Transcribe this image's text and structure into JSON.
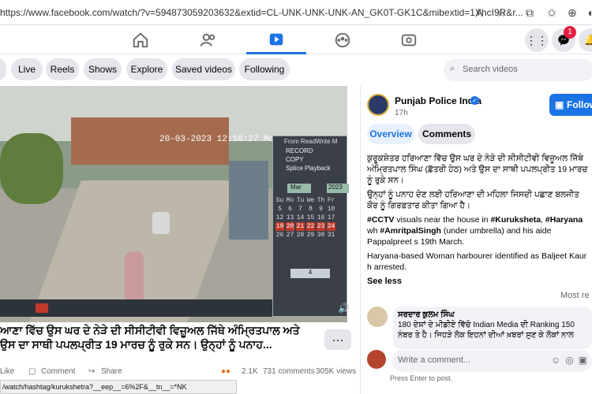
{
  "browser": {
    "url": "https://www.facebook.com/watch/?v=594873059203632&extid=CL-UNK-UNK-UNK-AN_GK0T-GK1C&mibextid=1YhcI9R&r..."
  },
  "nav": {
    "tabs": [
      "home-icon",
      "friends-icon",
      "watch-icon",
      "groups-icon",
      "gaming-icon"
    ],
    "active_tab": "watch-icon",
    "notification_count": "1"
  },
  "watch_nav": {
    "pills": [
      "e",
      "Live",
      "Reels",
      "Shows",
      "Explore",
      "Saved videos",
      "Following"
    ],
    "search_placeholder": "Search videos"
  },
  "video": {
    "timestamp": "20-03-2023 12:18:27 Mon",
    "control_panel": {
      "title": "From ReadWrite M",
      "options": [
        "RECORD",
        "COPY",
        "Splice Playback"
      ],
      "month": "Mar",
      "year": "2023",
      "weekdays": [
        "Su",
        "Mo",
        "Tu",
        "We",
        "Th",
        "Fr",
        "Sa"
      ],
      "days": [
        [
          "5",
          "6",
          "7",
          "8",
          "9",
          "10",
          "11"
        ],
        [
          "12",
          "13",
          "14",
          "15",
          "16",
          "17",
          "18"
        ],
        [
          "19",
          "20",
          "21",
          "22",
          "23",
          "24",
          "25"
        ],
        [
          "26",
          "27",
          "28",
          "29",
          "30",
          "31",
          ""
        ]
      ],
      "channel": "4"
    }
  },
  "overlay_caption": "ਆਣਾ ਵਿੱਚ ਉਸ ਘਰ ਦੇ ਨੇੜੇ ਦੀ ਸੀਸੀਟੀਵੀ ਵਿਜ਼ੂਅਲ ਜਿੱਥੇ ਅੰਮ੍ਰਿਤਪਾਲ ਅਤੇ ਉਸ ਦਾ ਸਾਥੀ ਪਪਲਪ੍ਰੀਤ 19 ਮਾਰਚ ਨੂੰ ਰੁਕੇ ਸਨ। ਉਨ੍ਹਾਂ ਨੂੰ ਪਨਾਹ...",
  "actions": {
    "like": "Like",
    "comment": "Comment",
    "share": "Share",
    "reactions": "2.1K",
    "comments_count": "731 comments",
    "views": "305K views"
  },
  "status_url": "/watch/hashtag/kurukshetra?__eep__=6%2F&__tn__=*NK",
  "post": {
    "page_name": "Punjab Police India",
    "time": "17h",
    "follow_label": "Follow",
    "tab_overview": "Overview",
    "tab_comments": "Comments",
    "desc_punjabi_1": "ਕੁਰੂਕਸ਼ੇਤਰ ਹਰਿਆਣਾ ਵਿੱਚ ਉਸ ਘਰ ਦੇ ਨੇੜੇ ਦੀ ਸੀਸੀਟੀਵੀ ਵਿਜ਼ੂਅਲ ਜਿੱਥੇ ਅੰਮ੍ਰਿਤਪਾਲ ਸਿੰਘ (ਛੱਤਰੀ ਹੇਠ) ਅਤੇ ਉਸ ਦਾ ਸਾਥੀ ਪਪਲਪ੍ਰੀਤ 19 ਮਾਰਚ ਨੂੰ ਰੁਕੇ ਸਨ।",
    "desc_punjabi_2": "ਉਨ੍ਹਾਂ ਨੂੰ ਪਨਾਹ ਦੇਣ ਲਈ ਹਰਿਆਣਾ ਦੀ ਮਹਿਲਾ ਜਿਸਦੀ ਪਛਾਣ ਬਲਜੀਤ ਕੌਰ ਨੂੰ ਗਿਰਫ਼ਤਾਰ ਕੀਤਾ ਗਿਆ ਹੈ।",
    "desc_en_1a": "#CCTV",
    "desc_en_1b": " visuals near the house in ",
    "desc_en_1c": "#Kuruksheta",
    "desc_en_1d": ", ",
    "desc_en_1e": "#Haryana",
    "desc_en_1f": " wh",
    "desc_en_1g": "#AmritpalSingh",
    "desc_en_1h": " (under umbrella) and his aide Pappalpreet s 19th March.",
    "desc_en_2": "Haryana-based Woman harbourer identified as Baljeet Kaur h arrested.",
    "see_less": "See less",
    "most_relevant": "Most re"
  },
  "comment": {
    "author": "ਸਰਦਾਰ ਕੁਲਮ ਸਿੰਘ",
    "text": "180 ਦੇਸ਼ਾਂ ਦੇ ਮੀਡੀਏ ਵਿੱਚੋ Indian Media ਦੀ Ranking 150 ਨੰਬਰ ਤੇ ਹੈ। ਜਿਹੜੇ ਲੋਕ ਇਹਨਾਂ ਦੀਆਂ ਖ਼ਬਰਾਂ ਸੁਣ ਕੇ ਲੋਕਾਂ ਨਾਲ"
  },
  "composer": {
    "placeholder": "Write a comment...",
    "hint": "Press Enter to post."
  }
}
